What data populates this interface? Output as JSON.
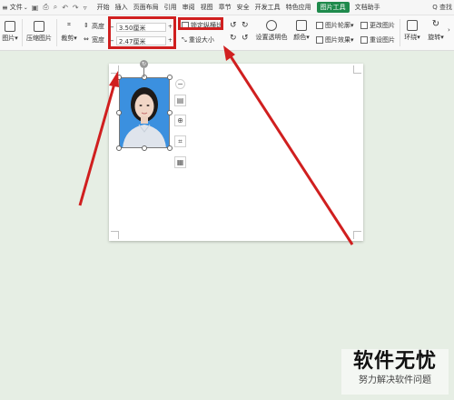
{
  "menubar": {
    "file_label": "文件",
    "tabs": [
      "开始",
      "插入",
      "页面布局",
      "引用",
      "审阅",
      "视图",
      "章节",
      "安全",
      "开发工具",
      "特色应用",
      "图片工具",
      "文档助手"
    ],
    "active_tab": "图片工具",
    "search_label": "Q 查找"
  },
  "ribbon": {
    "picture_label": "图片",
    "compress_label": "压缩图片",
    "crop_label": "裁剪",
    "height_label": "高度",
    "height_value": "3.50厘米",
    "width_label": "宽度",
    "width_value": "2.47厘米",
    "lock_ratio_label": "锁定纵横比",
    "reset_size_label": "重设大小",
    "transparent_label": "设置透明色",
    "color_label": "颜色",
    "outline_label": "图片轮廓",
    "effect_label": "图片效果",
    "change_label": "更改图片",
    "reset_label": "重设图片",
    "wrap_label": "环绕",
    "rotate_label": "旋转"
  },
  "colors": {
    "accent": "#1f8a4c",
    "highlight": "#d01f1f",
    "background": "#e6eee4"
  },
  "watermark": {
    "title": "软件无忧",
    "subtitle": "努力解决软件问题"
  }
}
